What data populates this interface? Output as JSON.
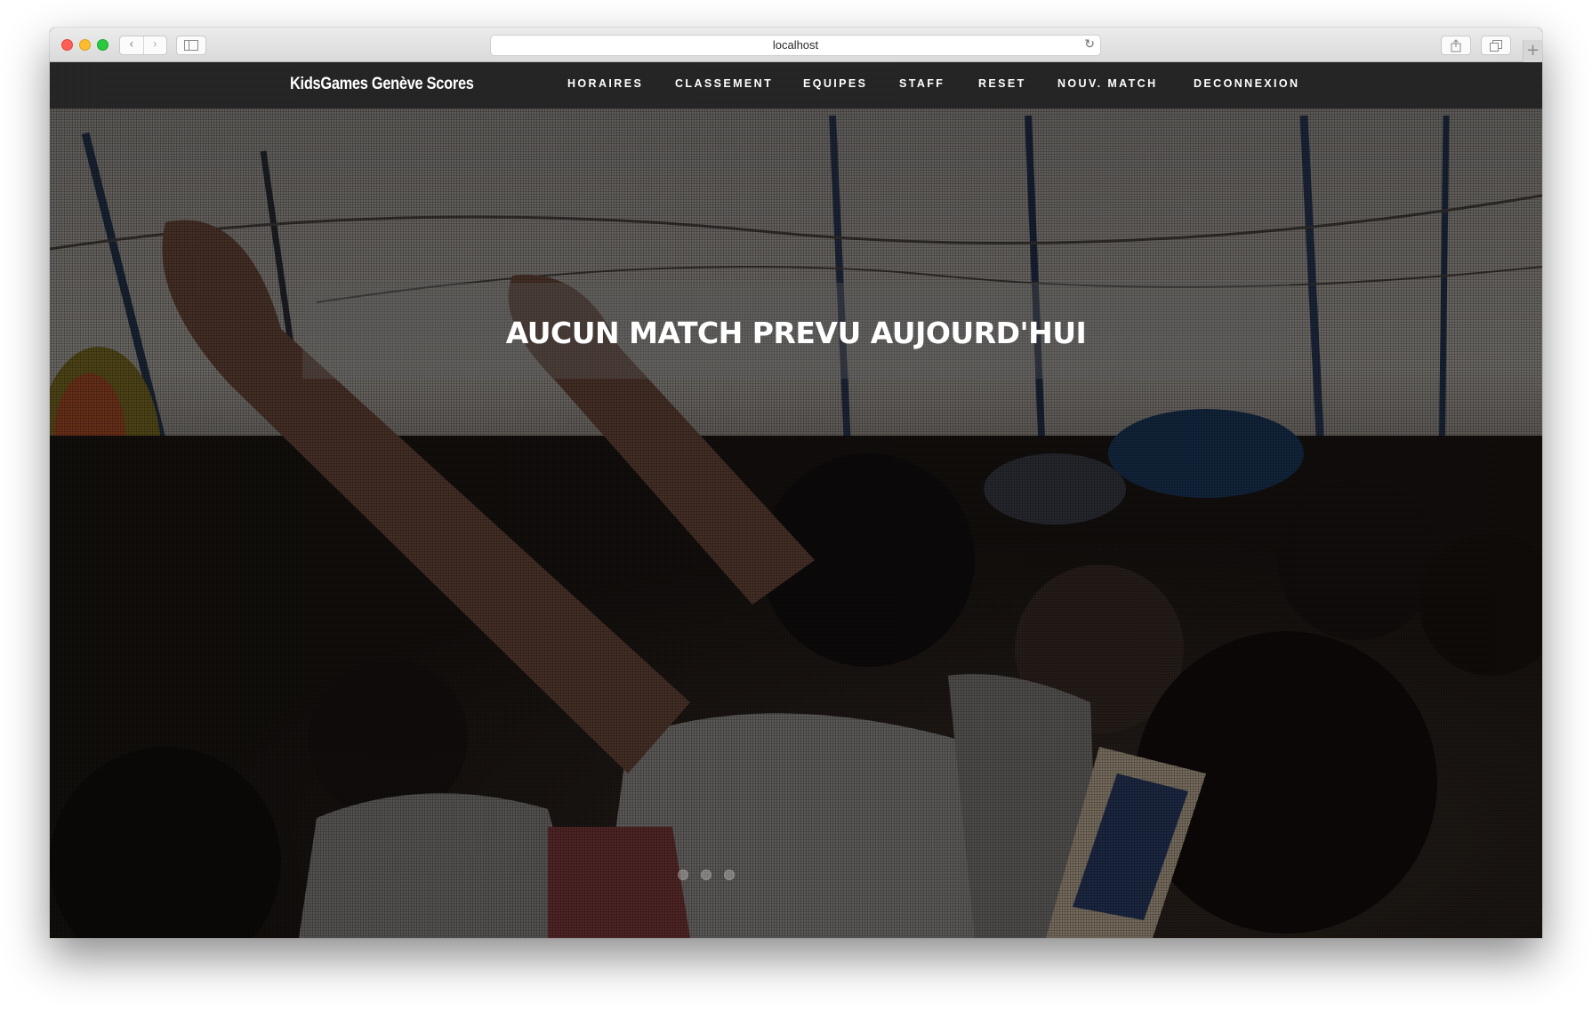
{
  "browser": {
    "url": "localhost",
    "back_icon": "‹",
    "forward_icon": "›",
    "reload_icon": "↻",
    "new_tab_icon": "+"
  },
  "site": {
    "brand": "KidsGames Genève Scores",
    "nav": [
      {
        "label": "HORAIRES"
      },
      {
        "label": "CLASSEMENT"
      },
      {
        "label": "EQUIPES"
      },
      {
        "label": "STAFF"
      },
      {
        "label": "RESET"
      },
      {
        "label": "NOUV. MATCH"
      },
      {
        "label": "DECONNEXION"
      }
    ],
    "heading": "AUCUN MATCH PREVU AUJOURD'HUI",
    "carousel": {
      "slide_count": 3,
      "active_index": 0
    }
  },
  "colors": {
    "navbar_bg": "#222222",
    "nav_text": "#ffffff",
    "heading_text": "#ffffff"
  }
}
